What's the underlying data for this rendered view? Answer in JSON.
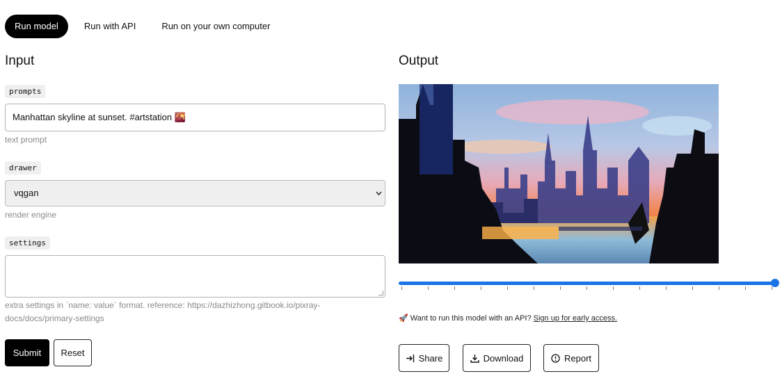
{
  "tabs": [
    {
      "label": "Run model",
      "active": true
    },
    {
      "label": "Run with API",
      "active": false
    },
    {
      "label": "Run on your own computer",
      "active": false
    }
  ],
  "input": {
    "heading": "Input",
    "prompts": {
      "label": "prompts",
      "value": "Manhattan skyline at sunset. #artstation 🌇",
      "hint": "text prompt"
    },
    "drawer": {
      "label": "drawer",
      "selected": "vqgan",
      "hint": "render engine"
    },
    "settings": {
      "label": "settings",
      "value": "",
      "hint_line1": "extra settings in `name: value` format. reference: https://dazhizhong.gitbook.io/pixray-",
      "hint_line2": "docs/docs/primary-settings"
    },
    "submit_label": "Submit",
    "reset_label": "Reset"
  },
  "output": {
    "heading": "Output",
    "slider_progress": 1.0,
    "slider_tick_count": 15,
    "api_note_prefix": "🚀 Want to run this model with an API? ",
    "api_note_link": "Sign up for early access.",
    "share_label": "Share",
    "download_label": "Download",
    "report_label": "Report"
  },
  "colors": {
    "accent": "#1a73e8",
    "primary_button": "#000000"
  },
  "icons": {
    "share": "share-arrow-icon",
    "download": "download-icon",
    "report": "alert-circle-icon",
    "select": "chevron-down-icon"
  }
}
